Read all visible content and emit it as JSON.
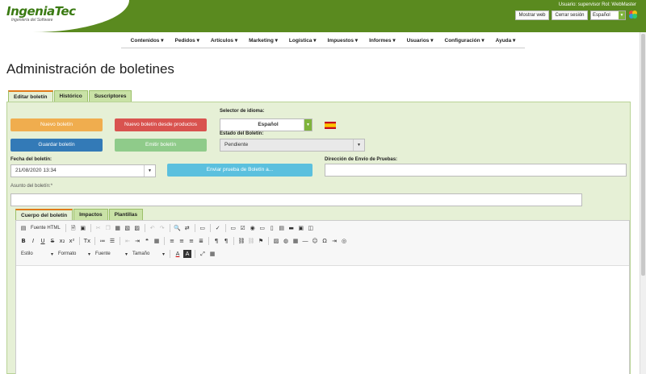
{
  "header": {
    "logo_text": "IngeniaTec",
    "logo_sub": "Ingeniería del Software",
    "user_info": "Usuario: supervisor Rol: WebMaster",
    "show_web": "Mostrar web",
    "logout": "Cerrar sesión",
    "language": "Español"
  },
  "nav": [
    "Contenidos ▾",
    "Pedidos ▾",
    "Artículos ▾",
    "Marketing ▾",
    "Logística ▾",
    "Impuestos ▾",
    "Informes ▾",
    "Usuarios ▾",
    "Configuración ▾",
    "Ayuda ▾"
  ],
  "page_title": "Administración de boletines",
  "tabs": [
    "Editar boletín",
    "Histórico",
    "Suscriptores"
  ],
  "form": {
    "btn_new": "Nuevo boletín",
    "btn_new_products": "Nuevo boletín desde productos",
    "btn_save": "Guardar boletín",
    "btn_emit": "Emitir boletín",
    "lang_selector_label": "Selector de idioma:",
    "lang_selector_value": "Español",
    "state_label": "Estado del Boletín:",
    "state_value": "Pendiente",
    "date_label": "Fecha del boletín:",
    "date_value": "21/08/2020 13:34",
    "btn_send_test": "Enviar prueba de Boletín a...",
    "test_email_label": "Dirección de Envío de Pruebas:",
    "subject_label": "Asunto del boletín:*"
  },
  "editor_tabs": [
    "Cuerpo del boletín",
    "Impactos",
    "Plantillas"
  ],
  "toolbar": {
    "source": "Fuente HTML",
    "style": "Estilo",
    "format": "Formato",
    "font": "Fuente",
    "size": "Tamaño"
  },
  "colors": {
    "header_green": "#5a8a1f",
    "panel_bg": "#e6f0d6",
    "btn_orange": "#f0ad4e",
    "btn_red": "#d9534f",
    "btn_blue": "#337ab7",
    "btn_green": "#8fcb8a",
    "btn_cyan": "#5bc0de"
  }
}
